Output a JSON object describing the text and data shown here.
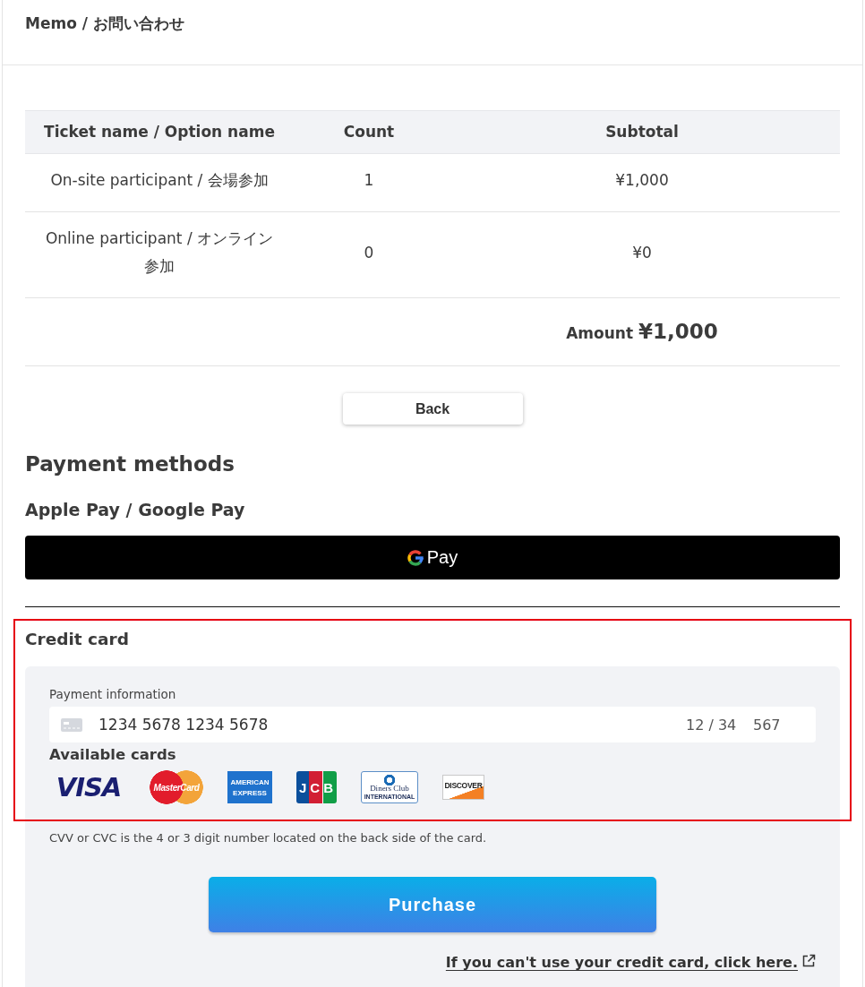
{
  "header": {
    "title": "Memo / お問い合わせ"
  },
  "order_table": {
    "columns": [
      "Ticket name / Option name",
      "Count",
      "Subtotal"
    ],
    "rows": [
      {
        "cells": [
          "On-site participant / 会場参加",
          "1",
          "¥1,000"
        ]
      },
      {
        "cells": [
          "Online participant / オンライン参加",
          "0",
          "¥0"
        ]
      }
    ],
    "total": {
      "label": "Amount",
      "value": "¥1,000"
    }
  },
  "back_button": {
    "label": "Back"
  },
  "payment_methods": {
    "title": "Payment methods",
    "wallet": {
      "title": "Apple Pay / Google Pay",
      "button_label": "Pay"
    },
    "credit_card": {
      "title": "Credit card",
      "highlighted": true,
      "payment_information": {
        "label": "Payment information",
        "card_number": "1234 5678 1234 5678",
        "expiry": "12 / 34",
        "cvc": "567"
      },
      "available_cards": {
        "label": "Available cards",
        "cards": [
          {
            "kind": "visa",
            "text": "VISA"
          },
          {
            "kind": "mastercard",
            "text": "MasterCard"
          },
          {
            "kind": "amex",
            "text": "AMERICAN",
            "subtext": "EXPRESS"
          },
          {
            "kind": "jcb",
            "text": "JCB"
          },
          {
            "kind": "diners",
            "text": "Diners Club",
            "subtext": "INTERNATIONAL"
          },
          {
            "kind": "discover",
            "text": "DISCOVER"
          }
        ]
      },
      "note": "CVV or CVC is the 4 or 3 digit number located on the back side of the card.",
      "purchase_button": {
        "label": "Purchase"
      },
      "help_link": {
        "label": "If you can't use your credit card, click here."
      }
    }
  }
}
